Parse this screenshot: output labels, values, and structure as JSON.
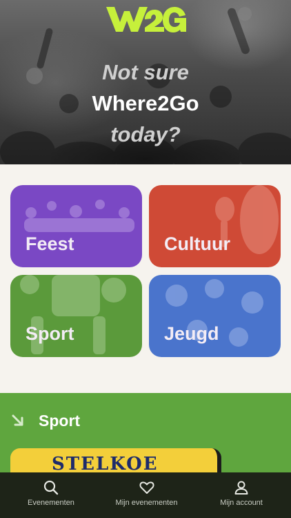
{
  "brand": {
    "logo_text": "W2G",
    "accent": "#c6f03b"
  },
  "hero": {
    "line1": "Not sure",
    "line2": "Where2Go",
    "line3": "today?"
  },
  "categories": [
    {
      "label": "Feest",
      "color": "#7a48c4"
    },
    {
      "label": "Cultuur",
      "color": "#cf4a36"
    },
    {
      "label": "Sport",
      "color": "#5b9a3b"
    },
    {
      "label": "Jeugd",
      "color": "#4a74cc"
    }
  ],
  "section": {
    "title": "Sport",
    "icon": "arrow-down-right-icon",
    "color": "#5fa63e",
    "card_text": "STELKOE"
  },
  "nav": {
    "items": [
      {
        "label": "Evenementen",
        "icon": "search-icon"
      },
      {
        "label": "Mijn evenementen",
        "icon": "heart-icon"
      },
      {
        "label": "Mijn account",
        "icon": "user-icon"
      }
    ]
  }
}
